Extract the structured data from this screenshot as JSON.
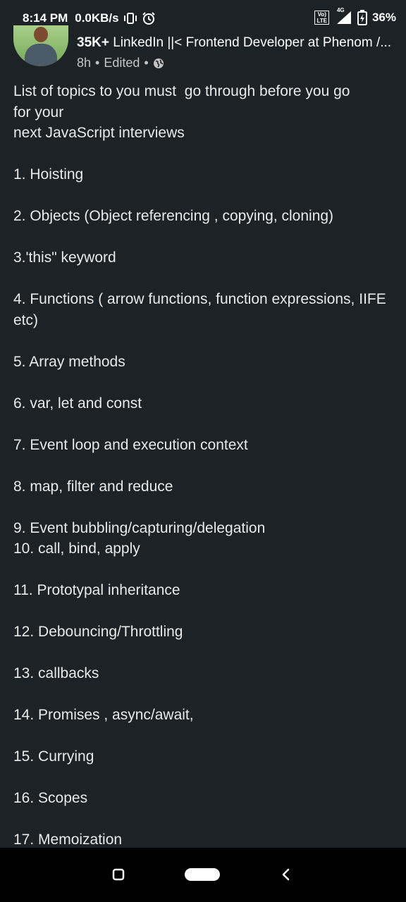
{
  "status_bar": {
    "time": "8:14 PM",
    "network_speed": "0.0KB/s",
    "volte_label_top": "Vo)",
    "volte_label_bottom": "LTE",
    "network_type": "4G",
    "battery_percent": "36%",
    "icons": [
      "vibrate-icon",
      "alarm-icon",
      "volte-icon",
      "signal-icon",
      "battery-icon"
    ]
  },
  "post": {
    "follower_count": "35K+",
    "author_headline": "LinkedIn ||< Frontend Developer at Phenom /...",
    "time_ago": "8h",
    "edited_label": "Edited",
    "separator": "•",
    "visibility_icon": "globe-icon",
    "intro_lines": [
      "List of topics to you must  go through before you go",
      "for your",
      "next JavaScript interviews"
    ],
    "topics": [
      "1. Hoisting",
      "2. Objects (Object referencing , copying, cloning)",
      "3.'this\" keyword",
      "4. Functions ( arrow functions, function expressions, IIFE etc)",
      "5. Array methods",
      "6. var, let and const",
      "7. Event loop and execution context",
      "8. map, filter and reduce",
      "9. Event bubbling/capturing/delegation",
      "10. call, bind, apply",
      "11. Prototypal inheritance",
      "12. Debouncing/Throttling",
      "13. callbacks",
      "14. Promises , async/await,",
      "15. Currying",
      "16. Scopes",
      "17. Memoization"
    ]
  },
  "nav_bar": {
    "buttons": [
      "recents-icon",
      "home-pill-icon",
      "back-icon"
    ]
  }
}
